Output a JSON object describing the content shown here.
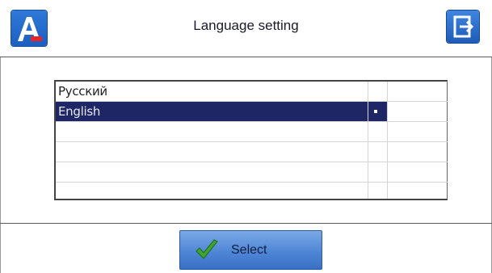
{
  "header": {
    "title": "Language setting"
  },
  "languages": {
    "rows": [
      {
        "label": "Русский",
        "selected": false
      },
      {
        "label": "English",
        "selected": true
      },
      {
        "label": "",
        "selected": false
      },
      {
        "label": "",
        "selected": false
      },
      {
        "label": "",
        "selected": false
      }
    ]
  },
  "footer": {
    "select_label": "Select"
  },
  "icons": {
    "logo": "app-logo-icon",
    "exit": "exit-icon",
    "check": "checkmark-icon"
  },
  "colors": {
    "accent": "#1f2665",
    "button": "#4f86d6",
    "logo_red": "#e3262a"
  }
}
